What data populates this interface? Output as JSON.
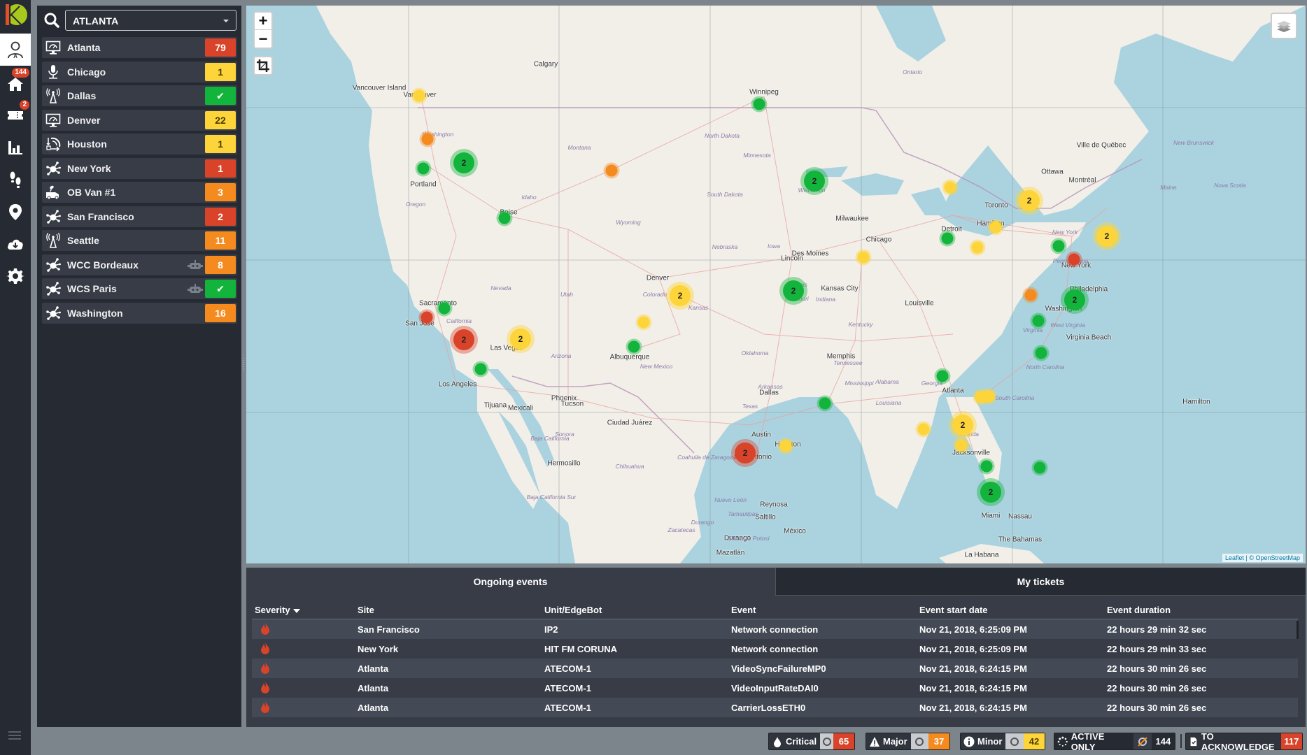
{
  "nav": {
    "items": [
      {
        "name": "profile",
        "icon": "user-admin-icon",
        "active": true
      },
      {
        "name": "sites",
        "icon": "home-icon",
        "badge": "144"
      },
      {
        "name": "tickets",
        "icon": "ticket-icon",
        "badge": "2"
      },
      {
        "name": "reports",
        "icon": "bar-chart-icon"
      },
      {
        "name": "tracking",
        "icon": "footsteps-icon"
      },
      {
        "name": "map",
        "icon": "location-pin-icon"
      },
      {
        "name": "download",
        "icon": "cloud-download-icon"
      },
      {
        "name": "settings",
        "icon": "gear-icon"
      }
    ]
  },
  "search": {
    "value": "ATLANTA"
  },
  "sites": [
    {
      "name": "Atlanta",
      "icon": "monitor-gauge-icon",
      "badge": "79",
      "status": "critical"
    },
    {
      "name": "Chicago",
      "icon": "microphone-icon",
      "badge": "1",
      "status": "minor"
    },
    {
      "name": "Dallas",
      "icon": "antenna-icon",
      "badge": "✔",
      "status": "ok"
    },
    {
      "name": "Denver",
      "icon": "monitor-gauge-icon",
      "badge": "22",
      "status": "minor"
    },
    {
      "name": "Houston",
      "icon": "satellite-dish-icon",
      "badge": "1",
      "status": "minor"
    },
    {
      "name": "New York",
      "icon": "network-hub-icon",
      "badge": "1",
      "status": "critical"
    },
    {
      "name": "OB Van #1",
      "icon": "ob-van-icon",
      "badge": "3",
      "status": "major"
    },
    {
      "name": "San Francisco",
      "icon": "network-hub-icon",
      "badge": "2",
      "status": "critical"
    },
    {
      "name": "Seattle",
      "icon": "antenna-icon",
      "badge": "11",
      "status": "major"
    },
    {
      "name": "WCC Bordeaux",
      "icon": "network-hub-icon",
      "badge": "8",
      "status": "major",
      "robot": true
    },
    {
      "name": "WCS Paris",
      "icon": "network-hub-icon",
      "badge": "✔",
      "status": "ok",
      "robot": true
    },
    {
      "name": "Washington",
      "icon": "network-hub-icon",
      "badge": "16",
      "status": "major"
    }
  ],
  "colors": {
    "critical": "#d9432a",
    "major": "#f58a1f",
    "minor": "#fdd43a",
    "ok": "#12b43c"
  },
  "map": {
    "zoom_in": "+",
    "zoom_out": "−",
    "attribution": "Leaflet | © OpenStreetMap",
    "cities": [
      "Calgary",
      "Vancouver",
      "Vancouver Island",
      "Winnipeg",
      "Portland",
      "Boise",
      "Sacramento",
      "San Jose",
      "Los Angeles",
      "Las Vegas",
      "Tijuana",
      "Mexicali",
      "Phoenix",
      "Tucson",
      "Albuquerque",
      "Ciudad Juárez",
      "Hermosillo",
      "Denver",
      "Lincoln",
      "Des Moines",
      "Kansas City",
      "Dallas",
      "Austin",
      "San Antonio",
      "Houston",
      "Reynosa",
      "Saltillo",
      "Durango",
      "Mazatlán",
      "México",
      "Milwaukee",
      "Chicago",
      "Detroit",
      "Toronto",
      "Hamilton",
      "Ottawa",
      "Montréal",
      "Ville de Québec",
      "Louisville",
      "Memphis",
      "Atlanta",
      "Jacksonville",
      "Miami",
      "Nassau",
      "The Bahamas",
      "La Habana",
      "New York",
      "Philadelphia",
      "Washington",
      "Virginia Beach",
      "Hamilton"
    ],
    "regions": [
      "Washington",
      "Oregon",
      "Idaho",
      "Montana",
      "Wyoming",
      "North Dakota",
      "South Dakota",
      "Nebraska",
      "Nevada",
      "Utah",
      "Colorado",
      "California",
      "Arizona",
      "New Mexico",
      "Kansas",
      "Oklahoma",
      "Texas",
      "Minnesota",
      "Wisconsin",
      "Iowa",
      "Missouri",
      "Illinois",
      "Indiana",
      "Kentucky",
      "Tennessee",
      "Arkansas",
      "Mississippi",
      "Alabama",
      "Georgia",
      "Louisiana",
      "Florida",
      "South Carolina",
      "North Carolina",
      "Virginia",
      "West Virginia",
      "Pennsylvania",
      "New York",
      "Maine",
      "New Brunswick",
      "Nova Scotia",
      "Ontario",
      "Baja California",
      "Baja California Sur",
      "Sonora",
      "Chihuahua",
      "Coahuila de Zaragoza",
      "Nuevo León",
      "Tamaulipas",
      "Durango",
      "Zacatecas",
      "San Luis Potosí"
    ],
    "markers": [
      {
        "status": "minor",
        "count": 1
      },
      {
        "status": "major",
        "count": 1
      },
      {
        "status": "ok",
        "count": 1
      },
      {
        "status": "ok",
        "count": 2
      },
      {
        "status": "ok",
        "count": 1
      },
      {
        "status": "major",
        "count": 1
      },
      {
        "status": "ok",
        "count": 1
      },
      {
        "status": "ok",
        "count": 2
      },
      {
        "status": "minor",
        "count": 1
      },
      {
        "status": "minor",
        "count": 1
      },
      {
        "status": "ok",
        "count": 1
      },
      {
        "status": "critical",
        "count": 1
      },
      {
        "status": "critical",
        "count": 2
      },
      {
        "status": "minor",
        "count": 2
      },
      {
        "status": "ok",
        "count": 1
      },
      {
        "status": "ok",
        "count": 1
      },
      {
        "status": "minor",
        "count": 1
      },
      {
        "status": "minor",
        "count": 2
      },
      {
        "status": "ok",
        "count": 1
      },
      {
        "status": "minor",
        "count": 1
      },
      {
        "status": "ok",
        "count": 2
      },
      {
        "status": "ok",
        "count": 1
      },
      {
        "status": "critical",
        "count": 2
      },
      {
        "status": "minor",
        "count": 1
      },
      {
        "status": "minor",
        "count": 1
      },
      {
        "status": "minor",
        "count": 1
      },
      {
        "status": "ok",
        "count": 1
      },
      {
        "status": "minor",
        "count": 1
      },
      {
        "status": "minor",
        "count": 2
      },
      {
        "status": "minor",
        "count": 2
      },
      {
        "status": "ok",
        "count": 1
      },
      {
        "status": "critical",
        "count": 1
      },
      {
        "status": "major",
        "count": 1
      },
      {
        "status": "ok",
        "count": 2
      },
      {
        "status": "ok",
        "count": 1
      },
      {
        "status": "ok",
        "count": 1
      },
      {
        "status": "ok",
        "count": 1
      },
      {
        "status": "minor",
        "count": 1
      },
      {
        "status": "minor",
        "count": 2
      },
      {
        "status": "minor",
        "count": 1
      },
      {
        "status": "ok",
        "count": 1
      },
      {
        "status": "ok",
        "count": 2
      }
    ]
  },
  "events": {
    "tabs": [
      {
        "label": "Ongoing events",
        "active": true
      },
      {
        "label": "My tickets",
        "active": false
      }
    ],
    "columns": [
      "Severity",
      "Site",
      "Unit/EdgeBot",
      "Event",
      "Event start date",
      "Event duration"
    ],
    "rows": [
      {
        "severity": "critical",
        "site": "San Francisco",
        "unit": "IP2",
        "event": "Network connection",
        "start": "Nov 21, 2018, 6:25:09 PM",
        "duration": "22 hours 29 min 32 sec"
      },
      {
        "severity": "critical",
        "site": "New York",
        "unit": "HIT FM CORUNA",
        "event": "Network connection",
        "start": "Nov 21, 2018, 6:25:09 PM",
        "duration": "22 hours 29 min 33 sec"
      },
      {
        "severity": "critical",
        "site": "Atlanta",
        "unit": "ATECOM-1",
        "event": "VideoSyncFailureMP0",
        "start": "Nov 21, 2018, 6:24:15 PM",
        "duration": "22 hours 30 min 26 sec"
      },
      {
        "severity": "critical",
        "site": "Atlanta",
        "unit": "ATECOM-1",
        "event": "VideoInputRateDAI0",
        "start": "Nov 21, 2018, 6:24:15 PM",
        "duration": "22 hours 30 min 26 sec"
      },
      {
        "severity": "critical",
        "site": "Atlanta",
        "unit": "ATECOM-1",
        "event": "CarrierLossETH0",
        "start": "Nov 21, 2018, 6:24:15 PM",
        "duration": "22 hours 30 min 26 sec"
      }
    ]
  },
  "statusbar": {
    "critical": {
      "label": "Critical",
      "count": "65"
    },
    "major": {
      "label": "Major",
      "count": "37"
    },
    "minor": {
      "label": "Minor",
      "count": "42"
    },
    "active_only": {
      "label": "ACTIVE ONLY",
      "count": "144"
    },
    "to_acknowledge": {
      "label": "TO ACKNOWLEDGE",
      "count": "117"
    }
  }
}
